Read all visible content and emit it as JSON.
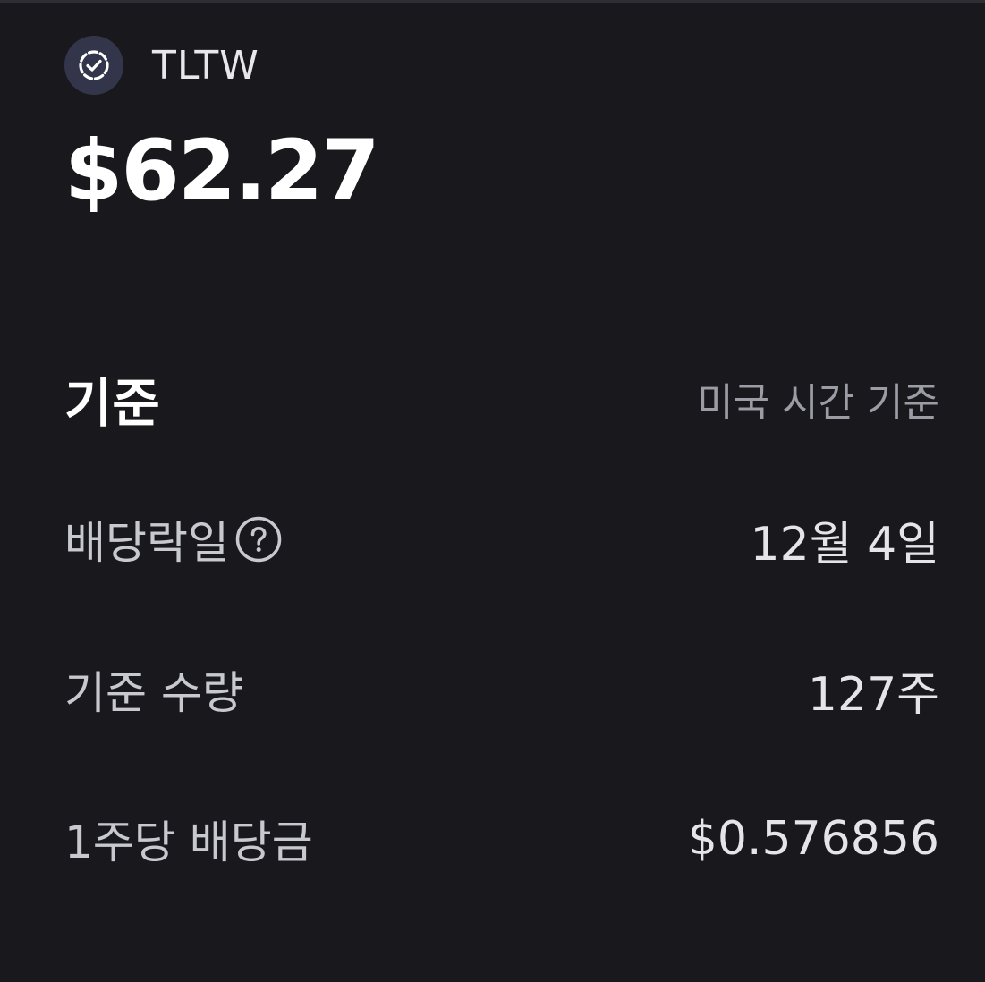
{
  "header": {
    "ticker": "TLTW",
    "logo_icon": "verified-badge-icon"
  },
  "price": "$62.27",
  "basis": {
    "title": "기준",
    "note": "미국 시간 기준"
  },
  "rows": [
    {
      "label": "배당락일",
      "value": "12월 4일",
      "help_icon": "question-circle-icon"
    },
    {
      "label": "기준 수량",
      "value": "127주"
    },
    {
      "label": "1주당 배당금",
      "value": "$0.576856"
    }
  ],
  "colors": {
    "background": "#18181d",
    "logo_bg": "#33364a",
    "muted_text": "#9c9ca4"
  }
}
